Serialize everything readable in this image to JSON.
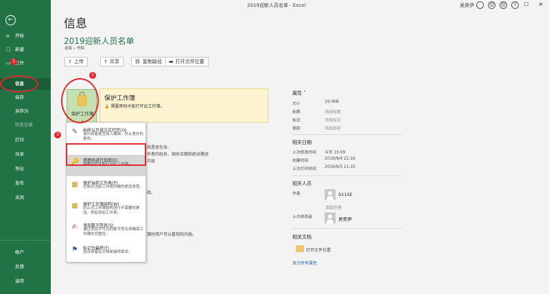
{
  "titlebar": {
    "doc_title": "2019迎新人员名单 - Excel",
    "user_name": "吴昊伊",
    "icons": [
      "smiley-icon",
      "frown-icon",
      "help-icon"
    ],
    "window_buttons": [
      "—",
      "☐",
      "✕"
    ]
  },
  "sidebar": {
    "items": [
      {
        "label": "开始",
        "icon": "⌂"
      },
      {
        "label": "新建",
        "icon": "▢"
      },
      {
        "label": "打开",
        "icon": "▭"
      },
      {
        "label": "信息",
        "icon": ""
      },
      {
        "label": "保存",
        "icon": ""
      },
      {
        "label": "另存为",
        "icon": ""
      },
      {
        "label": "历史记录",
        "icon": ""
      },
      {
        "label": "打印",
        "icon": ""
      },
      {
        "label": "共享",
        "icon": ""
      },
      {
        "label": "导出",
        "icon": ""
      },
      {
        "label": "发布",
        "icon": ""
      },
      {
        "label": "关闭",
        "icon": ""
      },
      {
        "label": "帐户",
        "icon": ""
      },
      {
        "label": "反馈",
        "icon": ""
      },
      {
        "label": "选项",
        "icon": ""
      }
    ]
  },
  "annotations": {
    "badge1": "1",
    "badge2": "2",
    "badge3": "3"
  },
  "main": {
    "page_title": "信息",
    "file_name": "2019迎新人员名单",
    "breadcrumb": "桌面 » 举稿",
    "actions": [
      {
        "label": "上传",
        "icon": "⇧"
      },
      {
        "label": "共享",
        "icon": "⇪"
      },
      {
        "label": "复制路径",
        "icon": "⛓"
      },
      {
        "label": "打开文件位置",
        "icon": "▬"
      }
    ],
    "protect": {
      "tile_label": "保护工作簿",
      "tile_chevron": "▾",
      "title": "保护工作簿",
      "desc": "需要密码才能打开此工作簿。"
    },
    "menu": [
      {
        "title": "始终以只读方式打开(O)",
        "desc": "询问读者是否加入编辑，防止意外的更改。",
        "icon": "✎"
      },
      {
        "title": "用密码进行加密(E)",
        "desc": "需要密码才能打开此工作簿。",
        "icon": "🔑"
      },
      {
        "title": "保护当前工作表(P)",
        "desc": "控制对当前工作表所做的更改类型。",
        "icon": "▦"
      },
      {
        "title": "保护工作簿结构(W)",
        "desc": "防止对工作簿结构进行不需要的更改，例如添加工作表。",
        "icon": "▦"
      },
      {
        "title": "添加数字签名(S)",
        "desc": "通过添加不可见的数字签名来确保工作簿的完整性。",
        "icon": "✍"
      },
      {
        "title": "标记为最终(F)",
        "desc": "告诉读者此文档是最终版本。",
        "icon": "⚑"
      }
    ],
    "bg_texts": [
      "其是否包含:",
      "作者的姓名、相关日期和绝对路径",
      "内容",
      "改。",
      "簿时用户可以看到的内容。"
    ]
  },
  "properties": {
    "title": "属性 ˅",
    "rows": [
      {
        "key": "大小",
        "value": "19.0KB",
        "link": false
      },
      {
        "key": "标题",
        "value": "添加标题",
        "link": true
      },
      {
        "key": "标记",
        "value": "添加标记",
        "link": true
      },
      {
        "key": "类别",
        "value": "添加类别",
        "link": true
      }
    ],
    "dates_title": "相关日期",
    "dates": [
      {
        "key": "上次修改时间",
        "value": "今天 15:09"
      },
      {
        "key": "创建时间",
        "value": "2019/9/4 22:16"
      },
      {
        "key": "上次打印时间",
        "value": "2019/9/5 21:33"
      }
    ],
    "people_title": "相关人员",
    "author_label": "作者",
    "author_name": "911SE",
    "add_author": "添加作者",
    "last_modified_by_label": "上次修改者",
    "last_modified_by": "吴昊伊",
    "docs_title": "相关文档",
    "open_location": "打开文件位置",
    "show_all": "显示所有属性"
  }
}
